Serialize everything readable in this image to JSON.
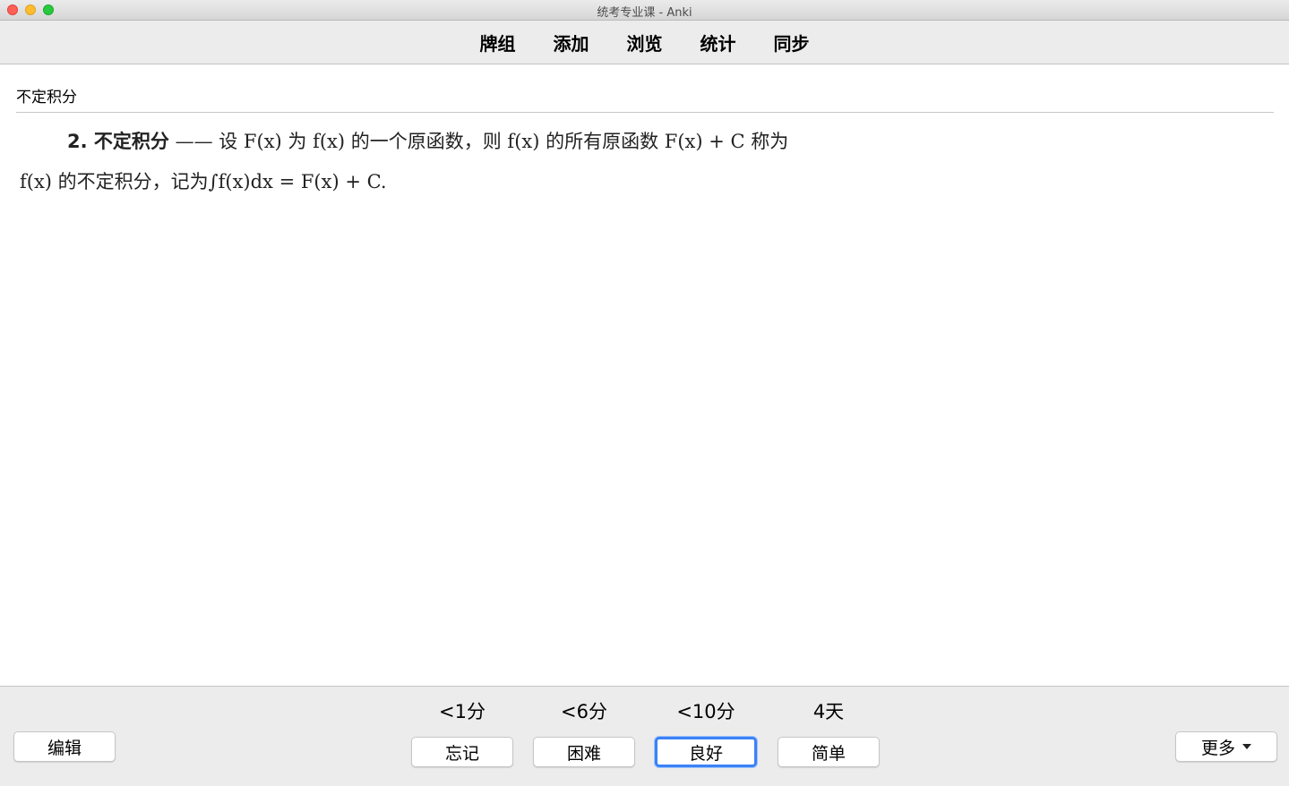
{
  "window": {
    "title": "统考专业课 - Anki"
  },
  "toolbar": {
    "items": [
      "牌组",
      "添加",
      "浏览",
      "统计",
      "同步"
    ]
  },
  "card": {
    "front": "不定积分",
    "back_line1_bold": "2. 不定积分",
    "back_line1_rest": " —— 设 F(x) 为 f(x) 的一个原函数，则 f(x) 的所有原函数 F(x) + C 称为",
    "back_line2": "f(x) 的不定积分，记为∫f(x)dx = F(x) + C."
  },
  "bottom": {
    "edit_label": "编辑",
    "more_label": "更多",
    "answers": [
      {
        "interval": "<1分",
        "label": "忘记"
      },
      {
        "interval": "<6分",
        "label": "困难"
      },
      {
        "interval": "<10分",
        "label": "良好"
      },
      {
        "interval": "4天",
        "label": "简单"
      }
    ]
  },
  "colors": {
    "focus_ring": "#3b82f6",
    "close": "#fe5f57",
    "minimize": "#febc2e",
    "maximize": "#28c840"
  }
}
